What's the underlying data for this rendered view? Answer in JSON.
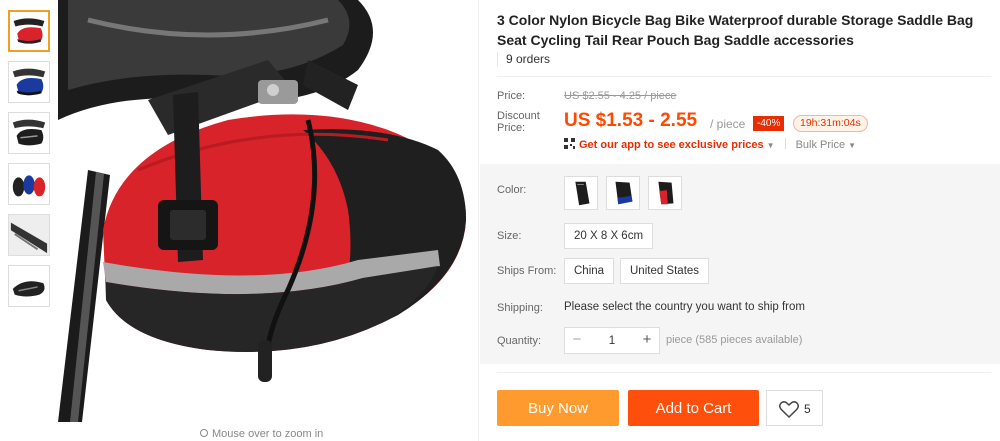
{
  "product": {
    "title": "3 Color Nylon Bicycle Bag Bike Waterproof durable Storage Saddle Bag Seat Cycling Tail Rear Pouch Bag Saddle accessories",
    "orders": "9 orders"
  },
  "gallery": {
    "thumbnail_count": 6,
    "active_index": 0,
    "zoom_hint": "Mouse over to zoom in"
  },
  "price": {
    "price_label": "Price:",
    "original": "US $2.55 - 4.25 / piece",
    "discount_label": "Discount Price:",
    "discount": "US $1.53 - 2.55",
    "unit": "/ piece",
    "discount_badge": "-40%",
    "countdown": "19h:31m:04s",
    "app_promo": "Get our app to see exclusive prices",
    "bulk_price": "Bulk Price"
  },
  "options": {
    "color_label": "Color:",
    "colors": [
      "black",
      "blue",
      "red"
    ],
    "size_label": "Size:",
    "size_value": "20 X 8 X 6cm",
    "ships_from_label": "Ships From:",
    "ships_from": [
      "China",
      "United States"
    ],
    "shipping_label": "Shipping:",
    "shipping_text": "Please select the country you want to ship from",
    "quantity_label": "Quantity:",
    "quantity_value": "1",
    "quantity_minus": "−",
    "quantity_plus": "+",
    "quantity_available": "piece (585 pieces available)"
  },
  "actions": {
    "buy_now": "Buy Now",
    "add_to_cart": "Add to Cart",
    "wishlist_count": "5"
  },
  "colors": {
    "discount_price": "#ff4800",
    "buy_now": "#ff9a2e",
    "add_to_cart": "#ff4f0d",
    "badge": "#e62e04"
  }
}
